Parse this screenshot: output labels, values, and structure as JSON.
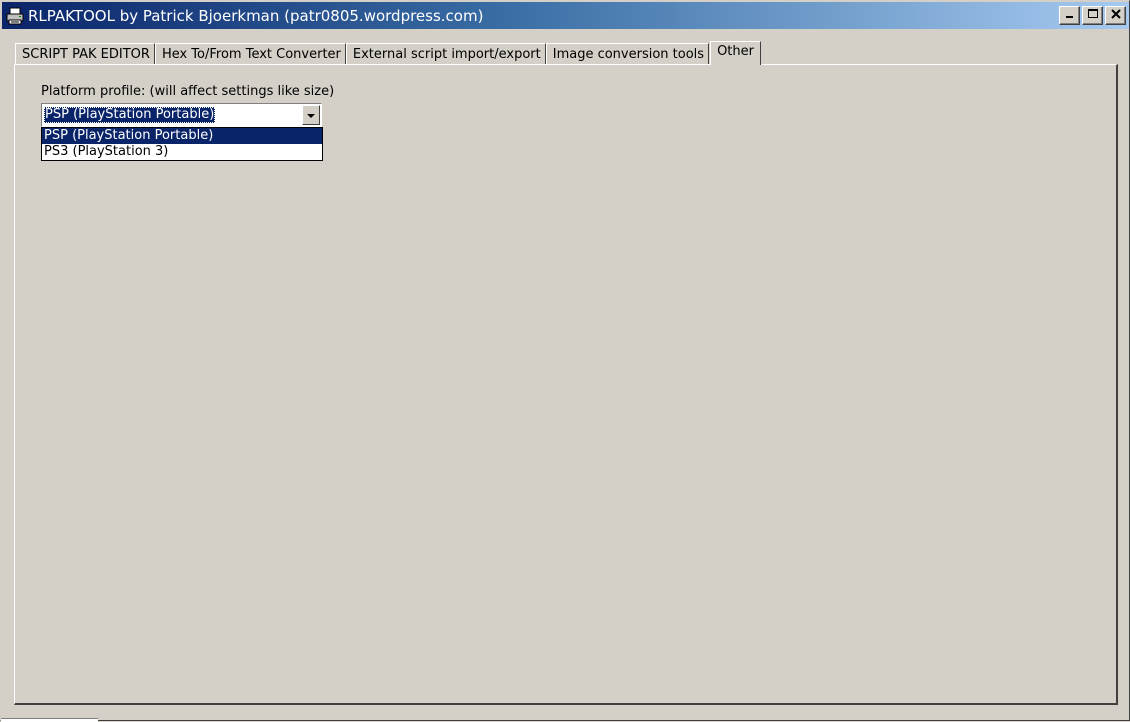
{
  "window": {
    "title": "RLPAKTOOL by Patrick Bjoerkman (patr0805.wordpress.com)",
    "app_icon": "printer-icon",
    "caption_buttons": [
      "minimize-icon",
      "maximize-icon",
      "close-icon"
    ]
  },
  "tabs": [
    {
      "label": "SCRIPT PAK EDITOR",
      "active": false
    },
    {
      "label": "Hex To/From Text Converter",
      "active": false
    },
    {
      "label": "External script import/export",
      "active": false
    },
    {
      "label": "Image conversion tools",
      "active": false
    },
    {
      "label": "Other",
      "active": true
    }
  ],
  "other_tab": {
    "platform_label": "Platform profile: (will affect settings like size)",
    "platform_combo": {
      "selected": "PSP (PlayStation Portable)",
      "options": [
        {
          "label": "PSP (PlayStation Portable)",
          "highlighted": true
        },
        {
          "label": "PS3 (PlayStation 3)",
          "highlighted": false
        }
      ]
    }
  },
  "colors": {
    "face": "#d4d0c8",
    "title_start": "#0a246a",
    "title_end": "#a6caf0",
    "selection": "#0a246a"
  }
}
